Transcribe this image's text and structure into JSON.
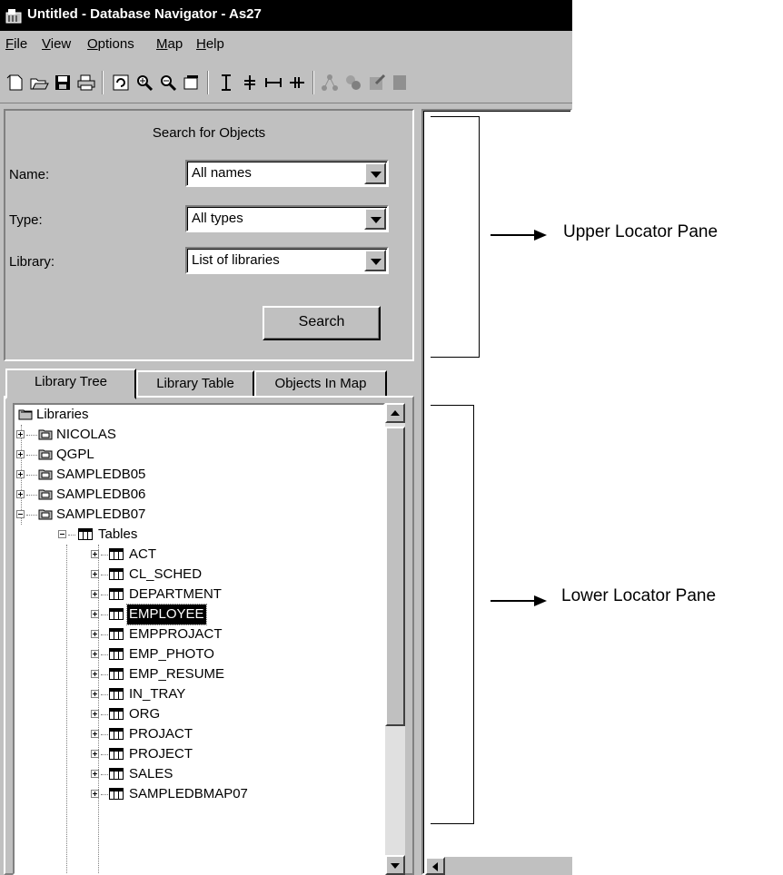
{
  "window": {
    "title": "Untitled - Database Navigator - As27"
  },
  "menu": [
    "File",
    "View",
    "Options",
    "Map",
    "Help"
  ],
  "toolbar": {
    "icons": [
      "new-icon",
      "open-icon",
      "save-icon",
      "print-icon",
      "refresh-icon",
      "zoom-in-icon",
      "zoom-out-icon",
      "window-icon",
      "height-icon",
      "center-vertical-icon",
      "width-icon",
      "center-horizontal-icon",
      "relationship-icon",
      "objects-icon",
      "edit-icon",
      "properties-icon"
    ]
  },
  "search": {
    "title": "Search for Objects",
    "name_label": "Name:",
    "name_value": "All names",
    "type_label": "Type:",
    "type_value": "All types",
    "library_label": "Library:",
    "library_value": "List of libraries",
    "search_button": "Search"
  },
  "tabs": [
    "Library Tree",
    "Library Table",
    "Objects In Map"
  ],
  "tree": {
    "root": "Libraries",
    "libraries": [
      "NICOLAS",
      "QGPL",
      "SAMPLEDB05",
      "SAMPLEDB06",
      "SAMPLEDB07"
    ],
    "tables_node": "Tables",
    "tables": [
      "ACT",
      "CL_SCHED",
      "DEPARTMENT",
      "EMPLOYEE",
      "EMPPROJACT",
      "EMP_PHOTO",
      "EMP_RESUME",
      "IN_TRAY",
      "ORG",
      "PROJACT",
      "PROJECT",
      "SALES",
      "SAMPLEDBMAP07"
    ],
    "selected": "EMPLOYEE"
  },
  "annotations": {
    "upper": "Upper Locator Pane",
    "lower": "Lower Locator Pane"
  }
}
